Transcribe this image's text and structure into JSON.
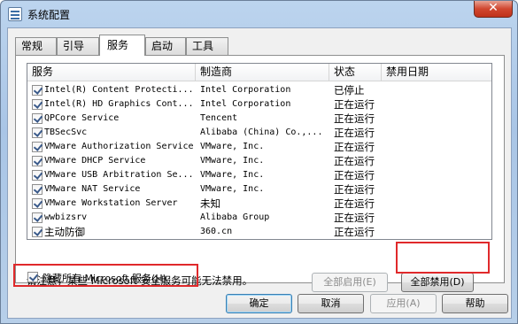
{
  "window": {
    "title": "系统配置",
    "close_icon": "close-icon",
    "close_glyph": "✕"
  },
  "tabs": [
    {
      "label": "常规",
      "active": false
    },
    {
      "label": "引导",
      "active": false
    },
    {
      "label": "服务",
      "active": true
    },
    {
      "label": "启动",
      "active": false
    },
    {
      "label": "工具",
      "active": false
    }
  ],
  "services": {
    "columns": [
      "服务",
      "制造商",
      "状态",
      "禁用日期"
    ],
    "rows": [
      {
        "checked": true,
        "name": "Intel(R) Content Protecti...",
        "maker": "Intel Corporation",
        "status": "已停止"
      },
      {
        "checked": true,
        "name": "Intel(R) HD Graphics Cont...",
        "maker": "Intel Corporation",
        "status": "正在运行"
      },
      {
        "checked": true,
        "name": "QPCore Service",
        "maker": "Tencent",
        "status": "正在运行"
      },
      {
        "checked": true,
        "name": "TBSecSvc",
        "maker": "Alibaba (China) Co.,...",
        "status": "正在运行"
      },
      {
        "checked": true,
        "name": "VMware Authorization Service",
        "maker": "VMware, Inc.",
        "status": "正在运行"
      },
      {
        "checked": true,
        "name": "VMware DHCP Service",
        "maker": "VMware, Inc.",
        "status": "正在运行"
      },
      {
        "checked": true,
        "name": "VMware USB Arbitration Se...",
        "maker": "VMware, Inc.",
        "status": "正在运行"
      },
      {
        "checked": true,
        "name": "VMware NAT Service",
        "maker": "VMware, Inc.",
        "status": "正在运行"
      },
      {
        "checked": true,
        "name": "VMware Workstation Server",
        "maker": "未知",
        "status": "正在运行"
      },
      {
        "checked": true,
        "name": "wwbizsrv",
        "maker": "Alibaba Group",
        "status": "正在运行"
      },
      {
        "checked": true,
        "name": "主动防御",
        "maker": "360.cn",
        "status": "正在运行"
      }
    ]
  },
  "note": "请注意，某些 Microsoft 安全服务可能无法禁用。",
  "buttons": {
    "enable_all": "全部启用(E)",
    "disable_all": "全部禁用(D)",
    "ok": "确定",
    "cancel": "取消",
    "apply": "应用(A)",
    "help": "帮助"
  },
  "hide_ms": {
    "checked": true,
    "label": "隐藏所有 Microsoft 服务(H)"
  },
  "annotation_color": "#e0292b"
}
